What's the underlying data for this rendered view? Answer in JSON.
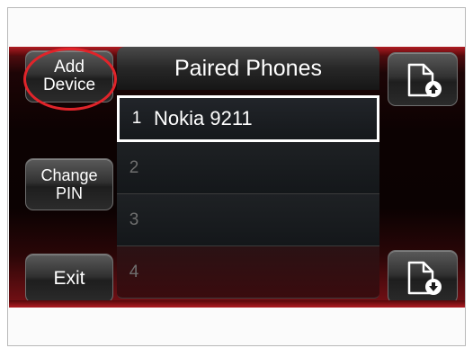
{
  "buttons": {
    "add_device": [
      "Add",
      "Device"
    ],
    "change_pin": [
      "Change",
      "PIN"
    ],
    "exit": "Exit"
  },
  "list": {
    "title": "Paired Phones",
    "rows": [
      {
        "num": "1",
        "name": "Nokia 9211",
        "selected": true
      },
      {
        "num": "2",
        "name": ""
      },
      {
        "num": "3",
        "name": ""
      },
      {
        "num": "4",
        "name": ""
      }
    ]
  },
  "icons": {
    "page_up": "page-up-icon",
    "page_down": "page-down-icon"
  },
  "colors": {
    "highlight": "#e0242a",
    "accent": "#8c1218"
  }
}
